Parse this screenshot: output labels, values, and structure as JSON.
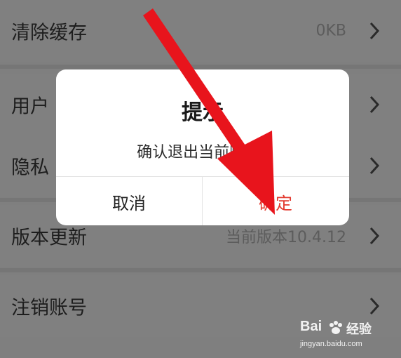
{
  "settings": {
    "items": [
      {
        "label": "清除缓存",
        "value": "0KB"
      },
      {
        "label": "用户",
        "value": ""
      },
      {
        "label": "隐私",
        "value": ""
      },
      {
        "label": "版本更新",
        "value": "当前版本10.4.12"
      },
      {
        "label": "注销账号",
        "value": ""
      }
    ]
  },
  "dialog": {
    "title": "提示",
    "message": "确认退出当前账号?",
    "cancel_label": "取消",
    "confirm_label": "确定"
  },
  "watermark": {
    "brand": "Bai",
    "brand_suffix": "经验",
    "url": "jingyan.baidu.com"
  },
  "colors": {
    "accent": "#e33a2f",
    "arrow": "#e8141c",
    "overlay": "#7f7f7f"
  }
}
